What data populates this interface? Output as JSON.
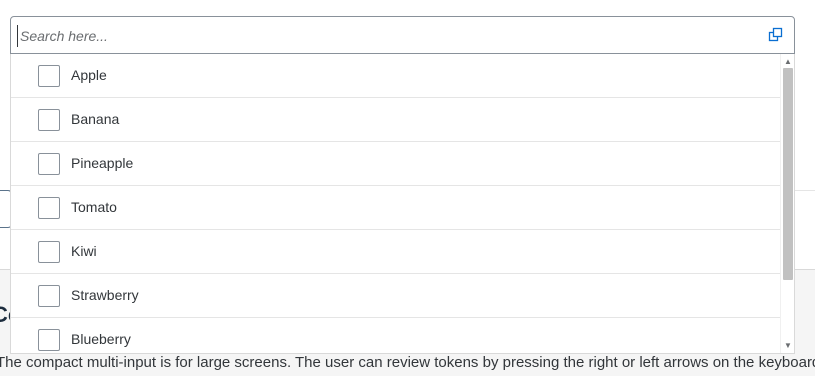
{
  "search": {
    "placeholder": "Search here...",
    "value": ""
  },
  "icons": {
    "value_help": "value-help-icon",
    "scroll_up": "arrow-up-icon",
    "scroll_down": "arrow-down-icon"
  },
  "list": {
    "items": [
      {
        "label": "Apple",
        "checked": false
      },
      {
        "label": "Banana",
        "checked": false
      },
      {
        "label": "Pineapple",
        "checked": false
      },
      {
        "label": "Tomato",
        "checked": false
      },
      {
        "label": "Kiwi",
        "checked": false
      },
      {
        "label": "Strawberry",
        "checked": false
      },
      {
        "label": "Blueberry",
        "checked": false
      }
    ]
  },
  "background": {
    "heading_fragment": "Co",
    "description": "The compact multi-input is for large screens. The user can review tokens by pressing the right or left arrows on the keyboard."
  },
  "colors": {
    "border": "#89919a",
    "text": "#32363a",
    "placeholder": "#6a6d70",
    "accent": "#0a6ed1"
  }
}
